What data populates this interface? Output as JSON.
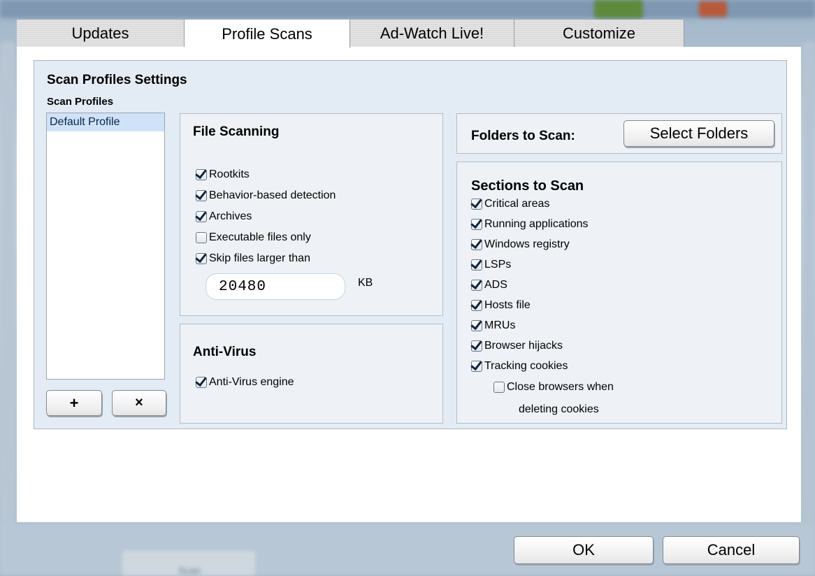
{
  "tabs": [
    {
      "label": "Updates"
    },
    {
      "label": "Profile Scans"
    },
    {
      "label": "Ad-Watch Live!"
    },
    {
      "label": "Customize"
    }
  ],
  "settings": {
    "title": "Scan Profiles Settings",
    "profiles_label": "Scan Profiles",
    "profiles": [
      "Default Profile"
    ],
    "add_label": "+",
    "remove_label": "×"
  },
  "file_scanning": {
    "title": "File Scanning",
    "options": [
      {
        "label": "Rootkits",
        "checked": true
      },
      {
        "label": "Behavior-based detection",
        "checked": true
      },
      {
        "label": "Archives",
        "checked": true
      },
      {
        "label": "Executable files only",
        "checked": false
      },
      {
        "label": "Skip files larger than",
        "checked": true
      }
    ],
    "size_value": "20480",
    "size_unit": "KB"
  },
  "anti_virus": {
    "title": "Anti-Virus",
    "engine_label": "Anti-Virus engine",
    "engine_checked": true
  },
  "folders": {
    "label": "Folders to Scan:",
    "button": "Select Folders"
  },
  "sections": {
    "title": "Sections to Scan",
    "items": [
      {
        "label": "Critical areas",
        "checked": true
      },
      {
        "label": "Running applications",
        "checked": true
      },
      {
        "label": "Windows registry",
        "checked": true
      },
      {
        "label": "LSPs",
        "checked": true
      },
      {
        "label": "ADS",
        "checked": true
      },
      {
        "label": "Hosts file",
        "checked": true
      },
      {
        "label": "MRUs",
        "checked": true
      },
      {
        "label": "Browser hijacks",
        "checked": true
      },
      {
        "label": "Tracking cookies",
        "checked": true
      }
    ],
    "close_browsers_line1": "Close browsers when",
    "close_browsers_line2": "deleting cookies",
    "close_browsers_checked": false
  },
  "footer": {
    "ok": "OK",
    "cancel": "Cancel",
    "background_button": "Scan"
  }
}
